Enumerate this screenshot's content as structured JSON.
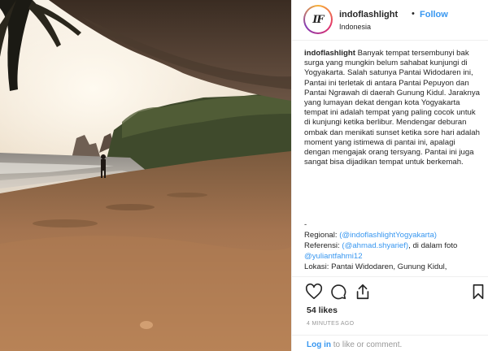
{
  "post": {
    "username": "indoflashlight",
    "separator": "•",
    "follow_label": "Follow",
    "location": "Indonesia",
    "avatar_initials": "IF",
    "caption_user": "indoflashlight",
    "caption_text": "Banyak tempat tersembunyi bak surga yang mungkin belum sahabat kunjungi di Yogyakarta. Salah satunya Pantai Widodaren ini, Pantai ini terletak di antara Pantai Pepuyon dan Pantai Ngrawah di daerah Gunung Kidul. Jaraknya yang lumayan dekat dengan kota Yogyakarta tempat ini adalah tempat yang paling cocok untuk di kunjungi ketika berlibur. Mendengar deburan ombak dan menikati sunset ketika sore hari adalah moment yang istimewa di pantai ini, apalagi dengan mengajak orang tersyang. Pantai ini juga sangat bisa dijadikan tempat untuk berkemah.",
    "caption_tail": [
      {
        "text": "-"
      },
      {
        "text": "Regional: ",
        "link": "(@indoflashlightYogyakarta)"
      },
      {
        "text": "Referensi: ",
        "link": "(@ahmad.shyarief)",
        "after": ", di dalam foto"
      },
      {
        "text": "",
        "link": "@yuliantfahmi12"
      },
      {
        "text": "Lokasi: Pantai Widodaren, Gunung Kidul,"
      }
    ],
    "likes_text": "54 likes",
    "time_text": "4 MINUTES AGO",
    "login_link": "Log in",
    "login_rest": " to like or comment."
  },
  "icons": {
    "like": "heart-icon",
    "comment": "comment-icon",
    "share": "share-icon",
    "save": "bookmark-icon"
  },
  "colors": {
    "link": "#3897f0",
    "text": "#262626",
    "muted": "#999999"
  }
}
